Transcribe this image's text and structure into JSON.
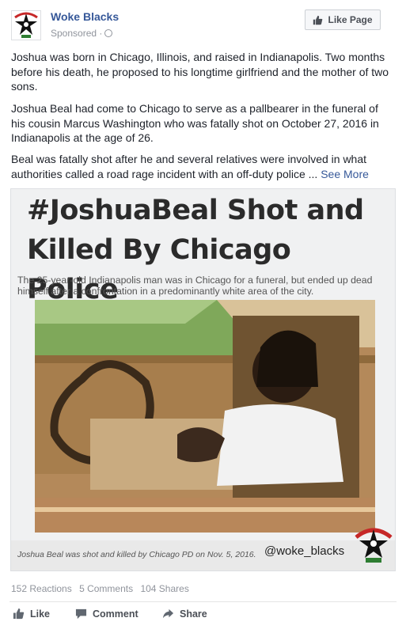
{
  "header": {
    "page_name": "Woke Blacks",
    "sponsored": "Sponsored ·",
    "like_page": "Like Page"
  },
  "body": {
    "p1": "Joshua was born in Chicago, Illinois, and raised in Indianapolis. Two months before his death, he proposed to his longtime girlfriend and the mother of two sons.",
    "p2": "Joshua Beal had come to Chicago to serve as a pallbearer in the funeral of his cousin Marcus Washington who was fatally shot on October 27, 2016 in Indianapolis at the age of 26.",
    "p3": "Beal was fatally shot after he and several relatives were involved in what authorities called a road rage incident with an off-duty police ...",
    "see_more": "See More"
  },
  "image": {
    "title": "#JoshuaBeal Shot and Killed By Chicago Police",
    "subtitle": "The 25-year-old Indianapolis man was in Chicago for a funeral, but ended up dead himself after a confrontation in a predominantly white area of the city.",
    "caption": "Joshua Beal was shot and killed by Chicago PD on Nov. 5, 2016.",
    "handle": "@woke_blacks"
  },
  "stats": {
    "reactions": "152 Reactions",
    "comments": "5 Comments",
    "shares": "104 Shares"
  },
  "actions": {
    "like": "Like",
    "comment": "Comment",
    "share": "Share"
  },
  "colors": {
    "link": "#365899",
    "muted": "#90949c",
    "text": "#1d2129"
  }
}
